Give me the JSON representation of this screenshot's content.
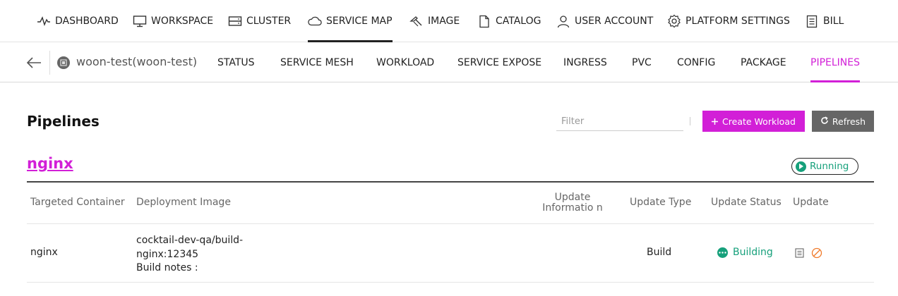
{
  "topnav": {
    "items": [
      {
        "label": "DASHBOARD",
        "icon": "pulse-icon"
      },
      {
        "label": "WORKSPACE",
        "icon": "monitor-icon"
      },
      {
        "label": "CLUSTER",
        "icon": "server-icon"
      },
      {
        "label": "SERVICE MAP",
        "icon": "cloud-icon",
        "active": true
      },
      {
        "label": "IMAGE",
        "icon": "image-icon"
      },
      {
        "label": "CATALOG",
        "icon": "document-icon"
      },
      {
        "label": "USER ACCOUNT",
        "icon": "user-icon"
      },
      {
        "label": "PLATFORM SETTINGS",
        "icon": "gear-icon"
      },
      {
        "label": "BILL",
        "icon": "bill-icon"
      }
    ]
  },
  "subnav": {
    "namespace": "woon-test(woon-test)",
    "tabs": [
      {
        "label": "STATUS"
      },
      {
        "label": "SERVICE MESH"
      },
      {
        "label": "WORKLOAD"
      },
      {
        "label": "SERVICE EXPOSE"
      },
      {
        "label": "INGRESS"
      },
      {
        "label": "PVC"
      },
      {
        "label": "CONFIG"
      },
      {
        "label": "PACKAGE"
      },
      {
        "label": "PIPELINES",
        "active": true
      }
    ]
  },
  "page": {
    "title": "Pipelines",
    "filter_placeholder": "Filter",
    "create_label": "Create Workload",
    "refresh_label": "Refresh"
  },
  "workload": {
    "name": "nginx",
    "status": "Running"
  },
  "table": {
    "headers": {
      "container": "Targeted Container",
      "image": "Deployment Image",
      "info": "Update Informatio n",
      "type": "Update Type",
      "status": "Update Status",
      "update": "Update"
    },
    "rows": [
      {
        "container": "nginx",
        "image_line1": "cocktail-dev-qa/build-",
        "image_line2": "nginx:12345",
        "image_line3": "Build notes :",
        "info": "",
        "type": "Build",
        "status": "Building"
      }
    ]
  },
  "colors": {
    "accent": "#d21fd7",
    "success": "#16a07b",
    "cancel": "#f07a2a",
    "refresh_bg": "#666666"
  }
}
